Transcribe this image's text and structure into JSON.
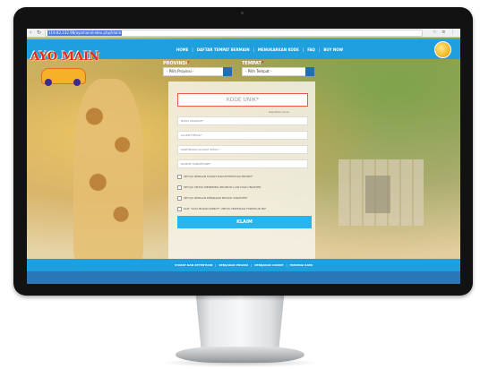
{
  "browser": {
    "url": "119.82.232.98/ayomain/index.php/klaim",
    "nav_back": "‹",
    "nav_reload": "↻",
    "toolbar_icons": "☆ ≡ ⋮"
  },
  "logo": {
    "text": "AYO MAIN"
  },
  "header": {
    "nav": [
      {
        "label": "HOME"
      },
      {
        "label": "DAFTAR TEMPAT BERMAIN"
      },
      {
        "label": "MENUKARKAN KODE"
      },
      {
        "label": "FAQ"
      },
      {
        "label": "BUY NOW"
      }
    ],
    "separator": "|"
  },
  "selectors": {
    "province_label": "PROVINSI",
    "province_required": "*",
    "province_value": "- Pilih Provinsi -",
    "place_label": "TEMPAT",
    "place_required": "*",
    "place_value": "- Pilih Tempat -"
  },
  "form": {
    "code_placeholder": "KODE UNIK*",
    "helper_link": "Dapatkan Kode",
    "fields": [
      {
        "placeholder": "NAMA LENGKAP*"
      },
      {
        "placeholder": "ALAMAT EMAIL*"
      },
      {
        "placeholder": "KONFIRMASI ALAMAT EMAIL*"
      },
      {
        "placeholder": "NOMOR HANDPHONE*"
      }
    ],
    "checkboxes": [
      {
        "label": "SETUJU DENGAN SYARAT DAN KETENTUAN PROMO*"
      },
      {
        "label": "SETUJU UNTUK MENERIMA PROMOSI LAIN DARI UNILEVER"
      },
      {
        "label": "SETUJU DENGAN KEBIJAKAN PRIVASI UNILEVER*"
      },
      {
        "label": "KLIK \"SAYA BUKAN ROBOT\" UNTUK VERIFIKASI FORMULIR INI*"
      }
    ],
    "submit_label": "KLAIM"
  },
  "footer": {
    "links": [
      {
        "label": "SYARAT DAN KETENTUAN"
      },
      {
        "label": "KEBIJAKAN PRIVASI"
      },
      {
        "label": "KEBIJAKAN COOKIE"
      },
      {
        "label": "HUBUNGI KAMI"
      }
    ],
    "separator": "|"
  },
  "colors": {
    "header_blue": "#1f9fde",
    "button_blue": "#26b5ef",
    "accent_red": "#e8262a",
    "bezel": "#121212"
  }
}
